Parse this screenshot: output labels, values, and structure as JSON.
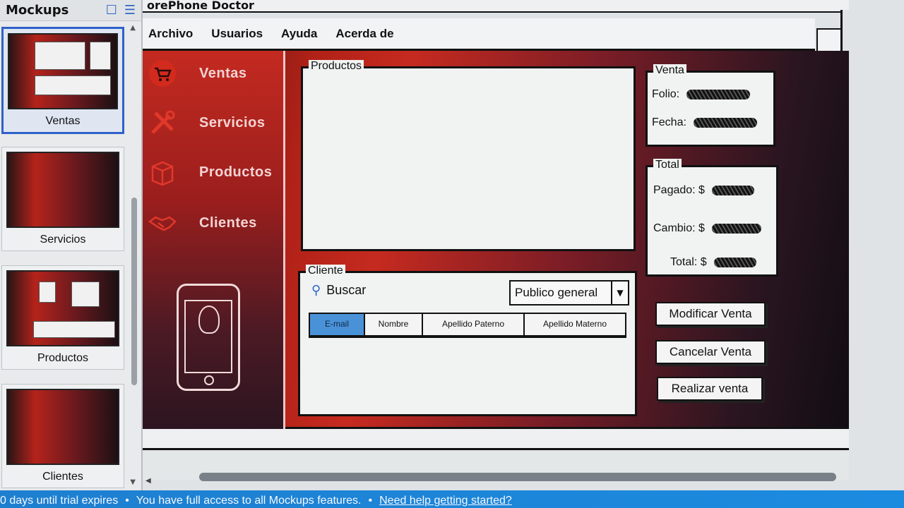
{
  "panel": {
    "title": "Mockups",
    "thumbnails": [
      {
        "label": "Ventas"
      },
      {
        "label": "Servicios"
      },
      {
        "label": "Productos"
      },
      {
        "label": "Clientes"
      }
    ]
  },
  "window": {
    "title": "orePhone Doctor"
  },
  "menu": [
    "Archivo",
    "Usuarios",
    "Ayuda",
    "Acerda de"
  ],
  "sidebar": {
    "items": [
      {
        "label": "Ventas",
        "icon": "cart-icon"
      },
      {
        "label": "Servicios",
        "icon": "tools-icon"
      },
      {
        "label": "Productos",
        "icon": "box-icon"
      },
      {
        "label": "Clientes",
        "icon": "handshake-icon"
      }
    ]
  },
  "productos": {
    "legend": "Productos"
  },
  "venta": {
    "legend": "Venta",
    "folio_label": "Folio:",
    "fecha_label": "Fecha:"
  },
  "total": {
    "legend": "Total",
    "pagado_label": "Pagado: $",
    "cambio_label": "Cambio: $",
    "total_label": "Total: $"
  },
  "cliente": {
    "legend": "Cliente",
    "search_label": "Buscar",
    "select_value": "Publico general",
    "tabs": [
      "E-mail",
      "Nombre",
      "Apellido Paterno",
      "Apellido Materno"
    ],
    "active_tab": "E-mail"
  },
  "actions": {
    "modificar": "Modificar Venta",
    "cancelar": "Cancelar Venta",
    "realizar": "Realizar venta"
  },
  "trial": {
    "days_text": "0 days until trial expires",
    "access_text": "You have full access to all Mockups features.",
    "help_link": "Need help getting started?"
  },
  "colors": {
    "accent": "#c52a1f",
    "selection": "#2f61c9",
    "tab_active": "#4a92d8"
  }
}
